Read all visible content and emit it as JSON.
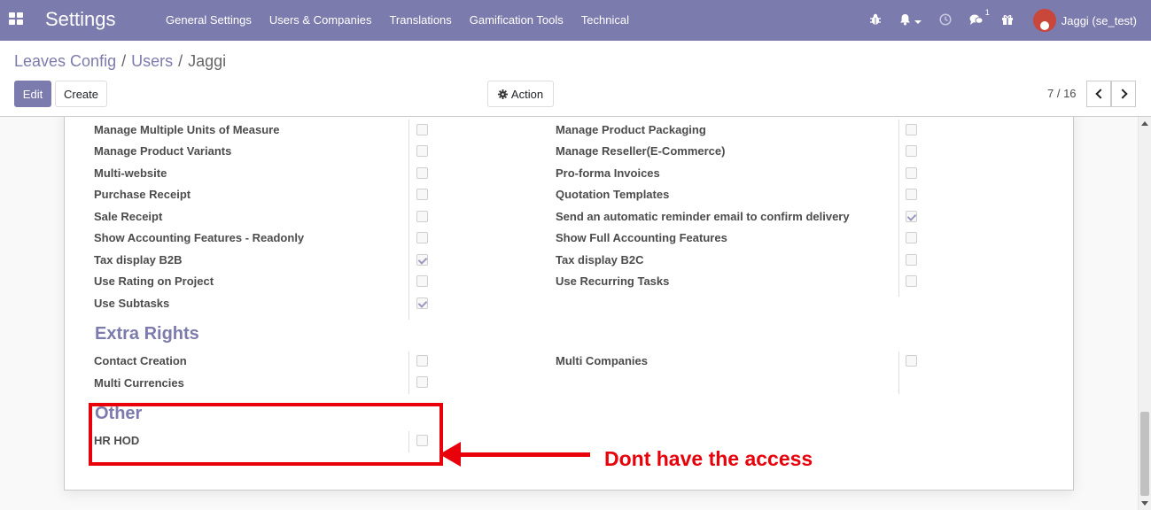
{
  "navbar": {
    "brand": "Settings",
    "menu": [
      "General Settings",
      "Users & Companies",
      "Translations",
      "Gamification Tools",
      "Technical"
    ],
    "messages_badge": "1",
    "user_name": "Jaggi (se_test)"
  },
  "breadcrumb": {
    "items": [
      "Leaves Config",
      "Users"
    ],
    "current": "Jaggi"
  },
  "buttons": {
    "edit": "Edit",
    "create": "Create",
    "action": "Action"
  },
  "pager": {
    "value": "7 / 16"
  },
  "rights_rows": [
    {
      "left": "Manage Multiple Units of Measure",
      "left_checked": false,
      "right": "Manage Product Packaging",
      "right_checked": false
    },
    {
      "left": "Manage Product Variants",
      "left_checked": false,
      "right": "Manage Reseller(E-Commerce)",
      "right_checked": false
    },
    {
      "left": "Multi-website",
      "left_checked": false,
      "right": "Pro-forma Invoices",
      "right_checked": false
    },
    {
      "left": "Purchase Receipt",
      "left_checked": false,
      "right": "Quotation Templates",
      "right_checked": false
    },
    {
      "left": "Sale Receipt",
      "left_checked": false,
      "right": "Send an automatic reminder email to confirm delivery",
      "right_checked": true
    },
    {
      "left": "Show Accounting Features - Readonly",
      "left_checked": false,
      "right": "Show Full Accounting Features",
      "right_checked": false
    },
    {
      "left": "Tax display B2B",
      "left_checked": true,
      "right": "Tax display B2C",
      "right_checked": false
    },
    {
      "left": "Use Rating on Project",
      "left_checked": false,
      "right": "Use Recurring Tasks",
      "right_checked": false
    },
    {
      "left": "Use Subtasks",
      "left_checked": true,
      "right": null,
      "right_checked": false
    }
  ],
  "extra_rights": {
    "title": "Extra Rights",
    "rows": [
      {
        "left": "Contact Creation",
        "left_checked": false,
        "right": "Multi Companies",
        "right_checked": false
      },
      {
        "left": "Multi Currencies",
        "left_checked": false,
        "right": null,
        "right_checked": false
      }
    ]
  },
  "other": {
    "title": "Other",
    "rows": [
      {
        "left": "HR HOD",
        "left_checked": false,
        "right": null,
        "right_checked": false
      }
    ]
  },
  "annotation": {
    "text": "Dont have the access",
    "color": "#e8000b"
  },
  "colors": {
    "navbar": "#7c7bad",
    "accent": "#7c7bad"
  }
}
